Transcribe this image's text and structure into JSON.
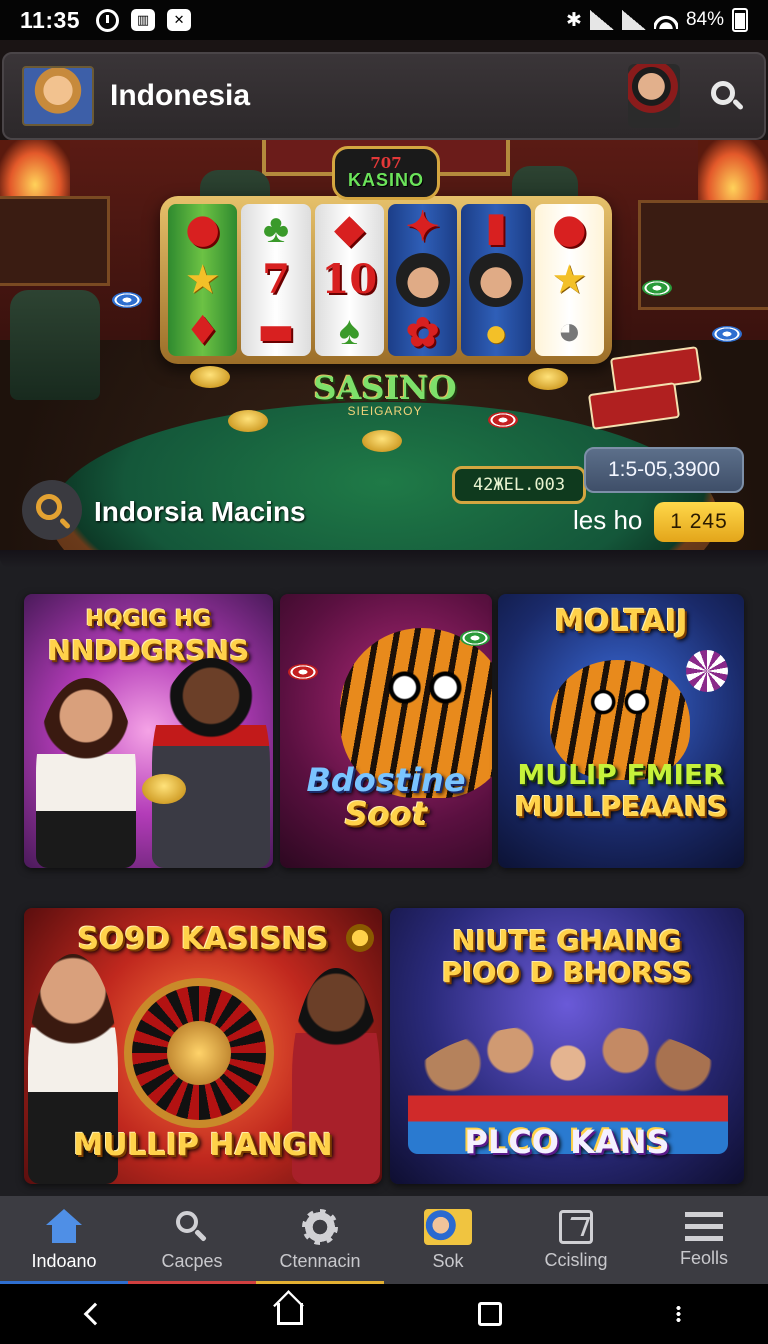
{
  "status_bar": {
    "time": "11:35",
    "battery": "84%"
  },
  "header": {
    "title": "Indonesia"
  },
  "hero": {
    "badge_top": "707",
    "badge_main": "KASINO",
    "counter": "42ЖЕL.003",
    "table_logo": "SASINO",
    "table_logo_sub": "SIEIGAROY",
    "balance": "1:5-05,3900",
    "caption": "Indorsia Macins",
    "points_label": "les ho",
    "points_value": "1 245"
  },
  "tiles": [
    {
      "title_small": "HQGIG HG",
      "title": "NNDDGRSNS"
    },
    {
      "title": "Bdostine",
      "title2": "Soot"
    },
    {
      "title": "MOLTAIJ",
      "sub1": "MULIP FMIER",
      "sub2": "MULLPEAANS"
    },
    {
      "title": "SO9D KASISNS",
      "bottom": "MULLIP HANGN"
    },
    {
      "title1": "NIUTE GHAING",
      "title2": "PIOO D BHORSS",
      "bottom": "PLCO KANS"
    }
  ],
  "bottom_nav": [
    {
      "label": "Indoano",
      "icon": "home-icon",
      "accent": "#2f6fd0"
    },
    {
      "label": "Cacpes",
      "icon": "search-icon",
      "accent": "#d04040"
    },
    {
      "label": "Ctennacin",
      "icon": "gear-icon",
      "accent": "#e3b032"
    },
    {
      "label": "Sok",
      "icon": "game-thumbnail-icon",
      "accent": "#3c3c42"
    },
    {
      "label": "Ccisling",
      "icon": "chart-icon",
      "accent": "#3c3c42"
    },
    {
      "label": "Feolls",
      "icon": "menu-icon",
      "accent": "#3c3c42"
    }
  ],
  "colors": {
    "gold": "#ffd24a",
    "active_nav": "#4f8fe6",
    "background": "#1e1e22"
  }
}
